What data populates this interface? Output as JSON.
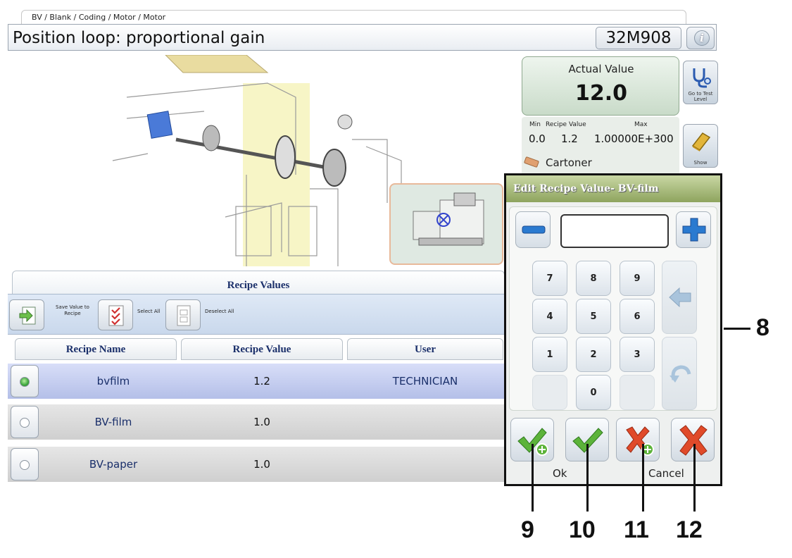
{
  "breadcrumb": "BV / Blank / Coding / Motor / Motor",
  "title": "Position loop: proportional gain",
  "parameter_code": "32M908",
  "info_icon": "info-icon",
  "actual_value": {
    "label": "Actual Value",
    "value": "12.0"
  },
  "limits": {
    "min_label": "Min",
    "min_value": "0.0",
    "recipe_label": "Recipe Value",
    "recipe_value": "1.2",
    "max_label": "Max",
    "max_value": "1.00000E+300"
  },
  "machine_name": "Cartoner",
  "side_buttons": {
    "test_level_label": "Go to Test Level",
    "show_label": "Show"
  },
  "recipe_values": {
    "title": "Recipe Values",
    "toolbar": {
      "save_label": "Save Value to Recipe",
      "select_all_label": "Select All",
      "deselect_all_label": "Deselect All"
    },
    "columns": [
      "Recipe Name",
      "Recipe Value",
      "User"
    ],
    "rows": [
      {
        "name": "bvfilm",
        "value": "1.2",
        "user": "TECHNICIAN",
        "selected": true
      },
      {
        "name": "BV-film",
        "value": "1.0",
        "user": "",
        "selected": false
      },
      {
        "name": "BV-paper",
        "value": "1.0",
        "user": "",
        "selected": false
      }
    ]
  },
  "dialog": {
    "title": "Edit Recipe Value- BV-film",
    "input_value": "",
    "keys": [
      "7",
      "8",
      "9",
      "4",
      "5",
      "6",
      "1",
      "2",
      "3",
      "0"
    ],
    "ok_label": "Ok",
    "cancel_label": "Cancel"
  },
  "callouts": {
    "c8": "8",
    "c9": "9",
    "c10": "10",
    "c11": "11",
    "c12": "12"
  },
  "colors": {
    "accent_green": "#3ca63c",
    "cancel_red": "#e04a2a",
    "blue_key": "#2a7ad0",
    "header_text": "#1a2f6a"
  }
}
